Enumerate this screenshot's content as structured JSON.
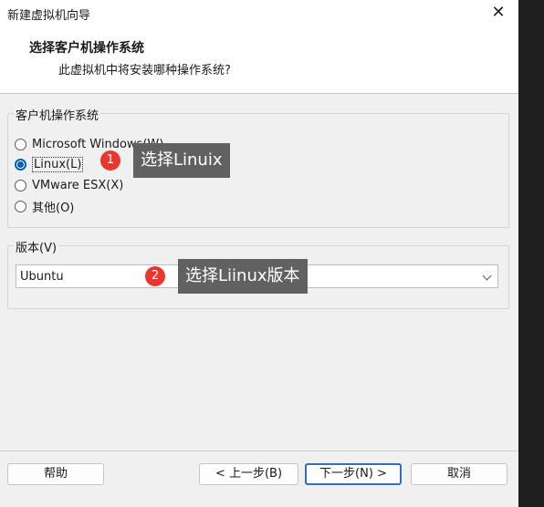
{
  "window": {
    "title": "新建虚拟机向导",
    "close_glyph": "✕"
  },
  "header": {
    "title": "选择客户机操作系统",
    "subtitle": "此虚拟机中将安装哪种操作系统?"
  },
  "os_group": {
    "label": "客户机操作系统",
    "options": [
      {
        "label": "Microsoft Windows(W)",
        "checked": false
      },
      {
        "label": "Linux(L)",
        "checked": true
      },
      {
        "label": "VMware ESX(X)",
        "checked": false
      },
      {
        "label": "其他(O)",
        "checked": false
      }
    ]
  },
  "version_group": {
    "label": "版本(V)",
    "selected": "Ubuntu"
  },
  "annotations": [
    {
      "number": "1",
      "text": "选择Linuix"
    },
    {
      "number": "2",
      "text": "选择Liinux版本"
    }
  ],
  "buttons": {
    "help": "帮助",
    "back": "< 上一步(B)",
    "next": "下一步(N) >",
    "cancel": "取消"
  },
  "colors": {
    "accent": "#005fb8",
    "badge": "#e8372e",
    "tooltip": "#616161"
  }
}
